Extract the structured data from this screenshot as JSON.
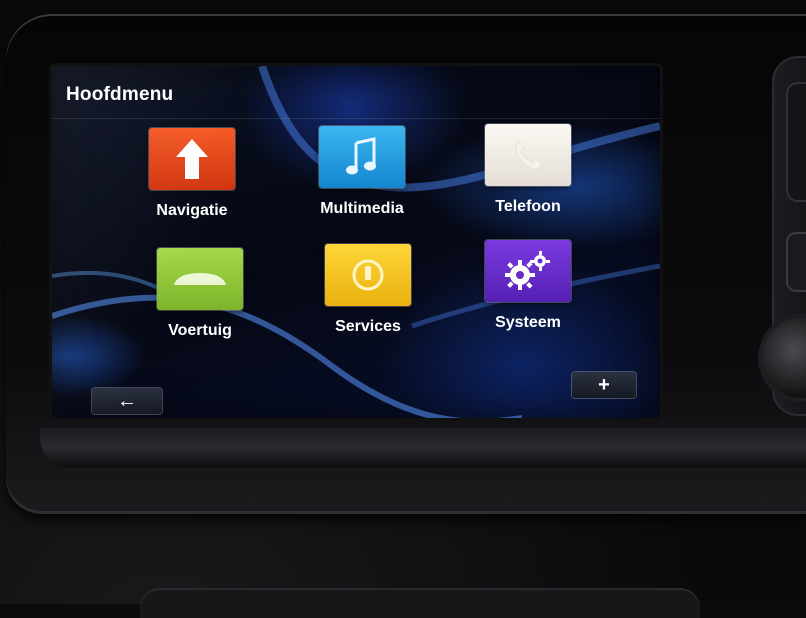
{
  "screen": {
    "title": "Hoofdmenu"
  },
  "menu": {
    "items": [
      {
        "label": "Navigatie",
        "icon": "navigation-arrow-icon",
        "color": "#e2431d"
      },
      {
        "label": "Multimedia",
        "icon": "music-note-icon",
        "color": "#1a9fe0"
      },
      {
        "label": "Telefoon",
        "icon": "phone-icon",
        "color": "#f1ece6"
      },
      {
        "label": "Voertuig",
        "icon": "vehicle-icon",
        "color": "#8fc93a"
      },
      {
        "label": "Services",
        "icon": "services-icon",
        "color": "#f2c21a"
      },
      {
        "label": "Systeem",
        "icon": "gears-icon",
        "color": "#6a2cc9"
      }
    ]
  },
  "footer": {
    "back_label": "←",
    "plus_label": "+"
  }
}
